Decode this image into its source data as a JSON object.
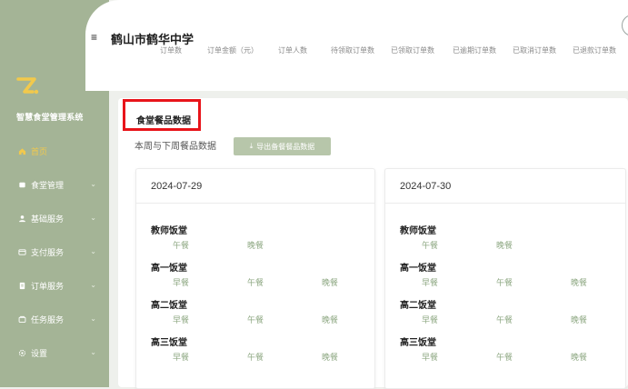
{
  "app": {
    "system_name": "智慧食堂管理系统",
    "school_name": "鹤山市鹤华中学",
    "menu_icon": "hamburger-icon"
  },
  "sidebar": {
    "items": [
      {
        "label": "首页",
        "icon": "home-icon",
        "active": true,
        "has_children": false
      },
      {
        "label": "食堂管理",
        "icon": "canteen-icon",
        "active": false,
        "has_children": true
      },
      {
        "label": "基础服务",
        "icon": "user-icon",
        "active": false,
        "has_children": true
      },
      {
        "label": "支付服务",
        "icon": "payment-icon",
        "active": false,
        "has_children": true
      },
      {
        "label": "订单服务",
        "icon": "order-icon",
        "active": false,
        "has_children": true
      },
      {
        "label": "任务服务",
        "icon": "task-icon",
        "active": false,
        "has_children": true
      },
      {
        "label": "设置",
        "icon": "settings-icon",
        "active": false,
        "has_children": true
      }
    ]
  },
  "stats": {
    "labels": [
      "订单数",
      "订单金额（元）",
      "订单人数",
      "待领取订单数",
      "已领取订单数",
      "已逾期订单数",
      "已取消订单数",
      "已退款订单数"
    ]
  },
  "section": {
    "title": "食堂餐品数据",
    "subtitle": "本周与下周餐品数据",
    "export_label": "导出备餐餐品数据"
  },
  "days": [
    {
      "date": "2024-07-29",
      "halls": [
        {
          "name": "教师饭堂",
          "meals": [
            "午餐",
            "晚餐"
          ]
        },
        {
          "name": "高一饭堂",
          "meals": [
            "早餐",
            "午餐",
            "晚餐"
          ]
        },
        {
          "name": "高二饭堂",
          "meals": [
            "早餐",
            "午餐",
            "晚餐"
          ]
        },
        {
          "name": "高三饭堂",
          "meals": [
            "早餐",
            "午餐",
            "晚餐"
          ]
        }
      ]
    },
    {
      "date": "2024-07-30",
      "halls": [
        {
          "name": "教师饭堂",
          "meals": [
            "午餐",
            "晚餐"
          ]
        },
        {
          "name": "高一饭堂",
          "meals": [
            "早餐",
            "午餐",
            "晚餐"
          ]
        },
        {
          "name": "高二饭堂",
          "meals": [
            "早餐",
            "午餐",
            "晚餐"
          ]
        },
        {
          "name": "高三饭堂",
          "meals": [
            "早餐",
            "午餐",
            "晚餐"
          ]
        }
      ]
    }
  ],
  "colors": {
    "sidebar_bg": "#a4b496",
    "active_menu": "#f2c94c",
    "logo": "#f2c94c",
    "meal_text": "#8fa984",
    "highlight": "#e8141a",
    "export_button": "#b7c6aa"
  }
}
